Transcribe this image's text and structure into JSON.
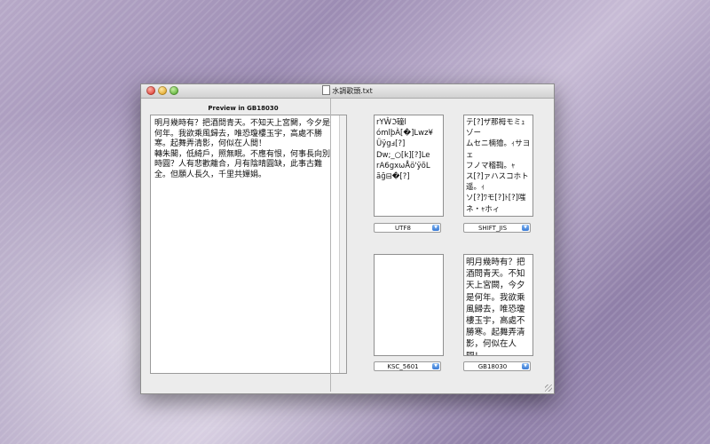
{
  "window": {
    "title": "水調歌頭.txt",
    "preview_title": "Preview in GB18030",
    "preview_text": "明月幾時有？把酒問青天。不知天上宮闕，今夕是何年。我欲乘風歸去，唯恐瓊樓玉宇，高處不勝寒。起舞弄清影，何似在人間！\n轉朱閣，低綺戶，照無眠。不應有恨，何事長向別時圓？人有悲歡離合，月有陰晴圓缺，此事古難全。但願人長久，千里共嬋娟。"
  },
  "encodings": [
    {
      "label": "UTF8",
      "text": "rYŴℑ䃥l\nómlþÀ[�]Lwz¥\nÜÿgⅎ[?]\nDw;_○[k][?]Le\nrA6gxωÅö'ÿõL\nãğ⊟�[?]"
    },
    {
      "label": "SHIFT_JIS",
      "text": "テ[?]ザ那栂モミｭゾー\nムセニ楠獪。ｨサヨェ\nフノマ稽鞫。ｬ\nス[?]ァハスコホト遥。ｨ\nソ[?]ﾜモ[?]ﾄ[?]嗤ネ・ｬホィ\nソヨェ x ヌ[?]｡ｬヤグ フ\n卑軸サルコョ。ﾂ[?]霰ェ\n[?]柄ー[?]ャコホセーセ。\n"
    },
    {
      "label": "KSC_5601",
      "text": ""
    },
    {
      "label": "GB18030",
      "text": "明月幾時有？把\n酒問青天。不知\n天上宮闕，今夕\n是何年。我欲乘\n風歸去，唯恐瓊\n樓玉宇，高處不\n勝寒。起舞弄清\n影，何似在人\n間！\n轉朱閣，低綺"
    }
  ],
  "icons": {
    "close": "close-button",
    "minimize": "minimize-button",
    "zoom": "zoom-button",
    "popup_arrow": "chevron-down-icon"
  }
}
